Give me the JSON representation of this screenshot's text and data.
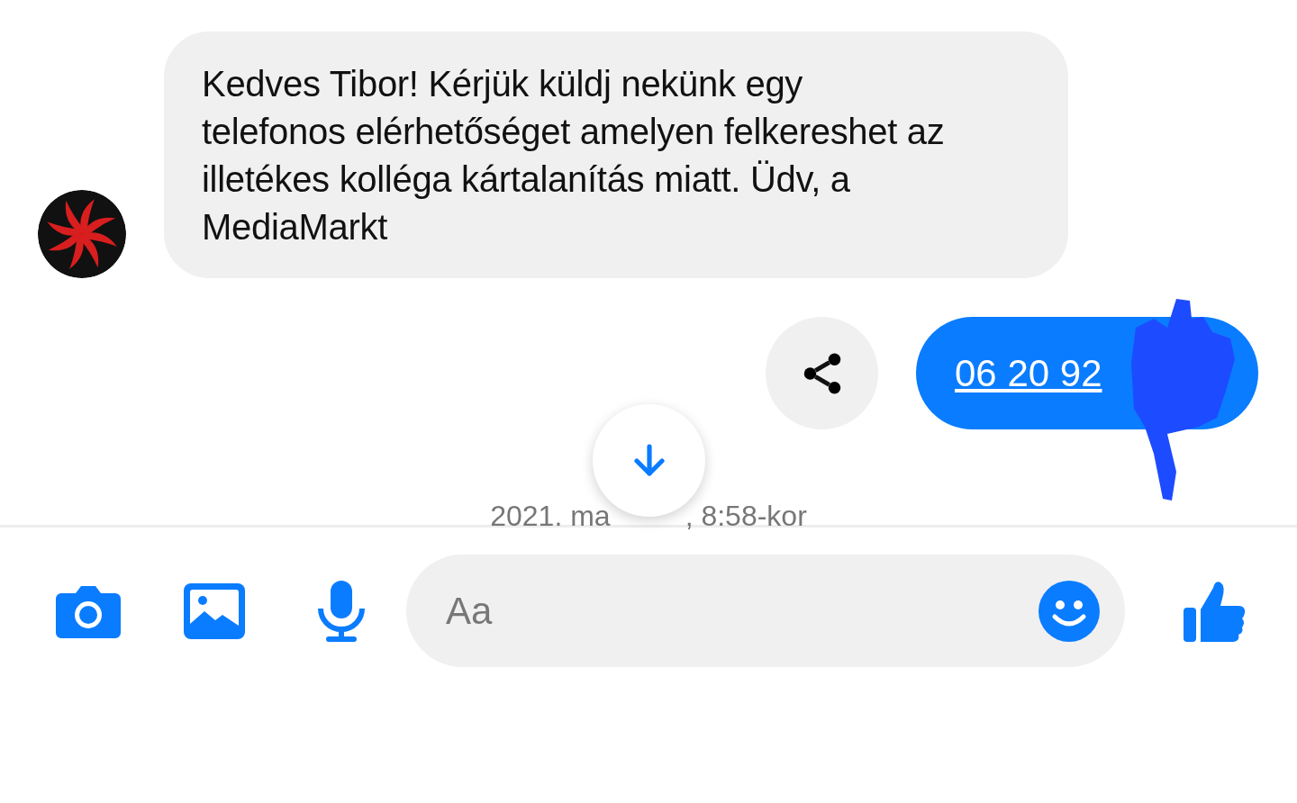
{
  "incoming_message": {
    "text": "Kedves Tibor! Kérjük küldj nekünk egy telefonos elérhetőséget amelyen felkereshet az illetékes kolléga kártalanítás miatt. Üdv, a MediaMarkt"
  },
  "outgoing_message": {
    "text": "06 20 92"
  },
  "timestamp": {
    "left": "2021. ma",
    "right": ", 8:58-kor"
  },
  "composer": {
    "placeholder": "Aa"
  }
}
